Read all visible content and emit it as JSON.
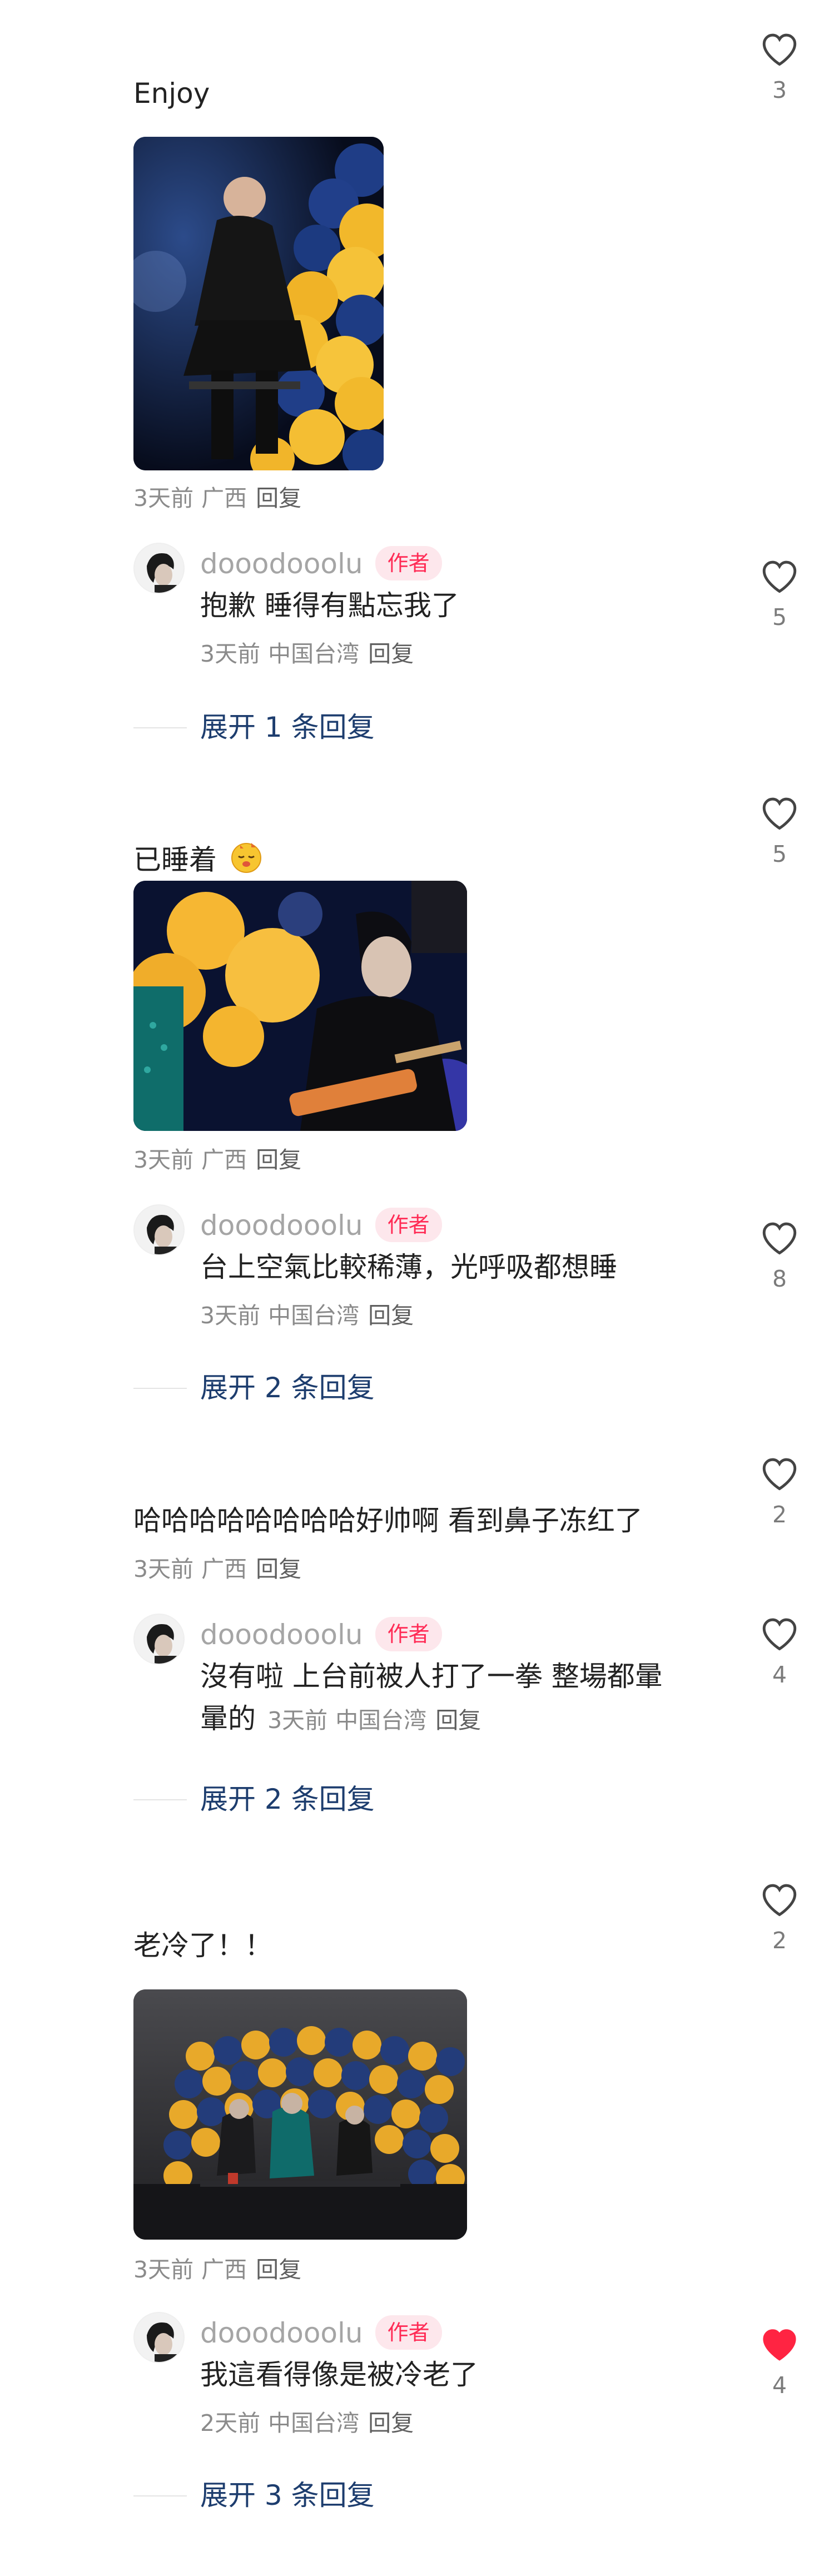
{
  "threads": [
    {
      "text": "Enjoy",
      "likes": "3",
      "meta": {
        "time": "3天前",
        "location": "广西",
        "reply": "回复"
      },
      "author_reply": {
        "name": "dooodooolu",
        "badge": "作者",
        "text": "抱歉 睡得有點忘我了",
        "meta": {
          "time": "3天前",
          "location": "中国台湾",
          "reply": "回复"
        },
        "likes": "5",
        "liked": false
      },
      "expand": "展开 1 条回复"
    },
    {
      "text": "已睡着",
      "emoji_icon": "sleeping-face-sticker-icon",
      "likes": "5",
      "meta": {
        "time": "3天前",
        "location": "广西",
        "reply": "回复"
      },
      "author_reply": {
        "name": "dooodooolu",
        "badge": "作者",
        "text": "台上空氣比較稀薄，光呼吸都想睡",
        "meta": {
          "time": "3天前",
          "location": "中国台湾",
          "reply": "回复"
        },
        "likes": "8",
        "liked": false
      },
      "expand": "展开 2 条回复"
    },
    {
      "text": "哈哈哈哈哈哈哈哈好帅啊 看到鼻子冻红了",
      "likes": "2",
      "meta": {
        "time": "3天前",
        "location": "广西",
        "reply": "回复"
      },
      "author_reply": {
        "name": "dooodooolu",
        "badge": "作者",
        "text_line1": "沒有啦 上台前被人打了一拳 整場都暈",
        "text_line2": "暈的",
        "meta": {
          "time": "3天前",
          "location": "中国台湾",
          "reply": "回复"
        },
        "likes": "4",
        "liked": false
      },
      "expand": "展开 2 条回复"
    },
    {
      "text": "老冷了！！",
      "likes": "2",
      "meta": {
        "time": "3天前",
        "location": "广西",
        "reply": "回复"
      },
      "author_reply": {
        "name": "dooodooolu",
        "badge": "作者",
        "text": "我這看得像是被冷老了",
        "meta": {
          "time": "2天前",
          "location": "中国台湾",
          "reply": "回复"
        },
        "likes": "4",
        "liked": true
      },
      "expand": "展开 3 条回复"
    }
  ],
  "colors": {
    "like_active": "#ff2442",
    "author_badge_text": "#ff2b55",
    "author_badge_bg": "#fde7ec",
    "expand_link": "#1d3d6e",
    "meta_gray": "#8b8b8b"
  },
  "icons": {
    "like": "heart-outline-icon",
    "liked": "heart-filled-icon"
  }
}
